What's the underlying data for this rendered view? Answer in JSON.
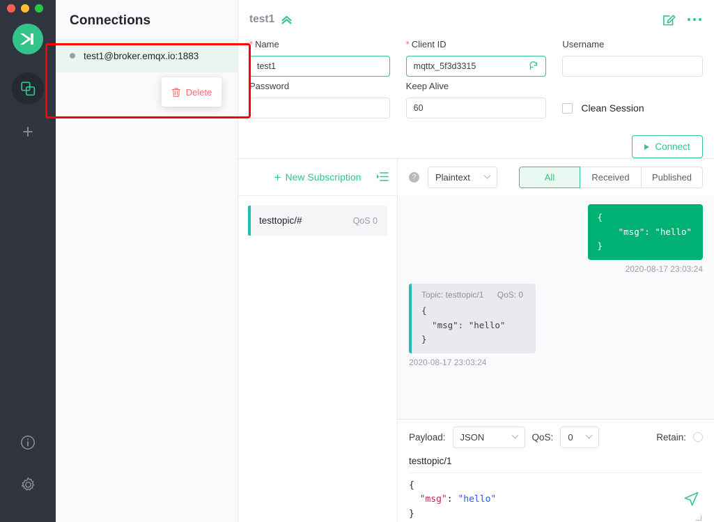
{
  "window": {
    "traffic_lights": [
      "close",
      "minimize",
      "maximize"
    ]
  },
  "rail": {
    "logo": "mqttx-logo",
    "items": [
      {
        "name": "connections",
        "icon": "connections-icon",
        "active": true
      },
      {
        "name": "new-connection",
        "icon": "plus-icon",
        "label": "+",
        "active": false
      }
    ],
    "bottom": [
      {
        "name": "about",
        "icon": "info-icon"
      },
      {
        "name": "settings",
        "icon": "gear-icon"
      }
    ]
  },
  "connections": {
    "title": "Connections",
    "items": [
      {
        "name": "test1@broker.emqx.io:1883",
        "status": "disconnected"
      }
    ],
    "context_menu": {
      "delete_label": "Delete",
      "icon": "trash-icon"
    }
  },
  "header": {
    "title": "test1",
    "collapse_icon": "double-chevron-up-icon",
    "edit_icon": "edit-icon",
    "more_icon": "more-dots-icon"
  },
  "form": {
    "name": {
      "label": "Name",
      "required": true,
      "value": "test1"
    },
    "client_id": {
      "label": "Client ID",
      "required": true,
      "value": "mqttx_5f3d3315",
      "refresh_icon": "refresh-icon"
    },
    "username": {
      "label": "Username",
      "required": false,
      "value": ""
    },
    "password": {
      "label": "Password",
      "required": false,
      "value": ""
    },
    "keep_alive": {
      "label": "Keep Alive",
      "required": false,
      "value": "60"
    },
    "clean_session": {
      "label": "Clean Session",
      "checked": false
    },
    "connect_button": {
      "label": "Connect",
      "icon": "play-icon"
    }
  },
  "subscriptions": {
    "new_label": "New Subscription",
    "plus": "+",
    "list_icon": "subscription-list-icon",
    "items": [
      {
        "topic": "testtopic/#",
        "qos": "QoS 0"
      }
    ]
  },
  "messages": {
    "help_icon": "?",
    "format": {
      "value": "Plaintext",
      "chevron": "chevron-down-icon"
    },
    "tabs": [
      {
        "label": "All",
        "active": true
      },
      {
        "label": "Received",
        "active": false
      },
      {
        "label": "Published",
        "active": false
      }
    ],
    "items": [
      {
        "direction": "published",
        "body": "{\n    \"msg\": \"hello\"\n}",
        "timestamp": "2020-08-17 23:03:24"
      },
      {
        "direction": "received",
        "topic_label": "Topic: testtopic/1",
        "qos_label": "QoS: 0",
        "body": "{\n  \"msg\": \"hello\"\n}",
        "timestamp": "2020-08-17 23:03:24"
      }
    ]
  },
  "publish": {
    "payload_label": "Payload:",
    "payload_value": "JSON",
    "qos_label": "QoS:",
    "qos_value": "0",
    "retain_label": "Retain:",
    "retain_checked": false,
    "topic": "testtopic/1",
    "editor": {
      "line1": "{",
      "key": "\"msg\"",
      "colon": ": ",
      "value": "\"hello\"",
      "line3": "}"
    },
    "send_icon": "send-icon"
  },
  "colors": {
    "accent_green": "#34c388",
    "bubble_green": "#00b173",
    "teal_bar": "#1fc0b0",
    "danger_red": "#f56c6c",
    "annotation_red": "#ff0000",
    "rail_bg": "#31353f"
  }
}
